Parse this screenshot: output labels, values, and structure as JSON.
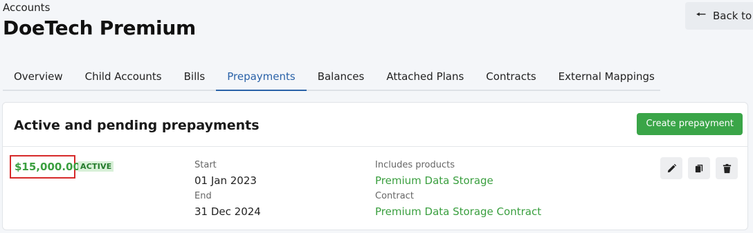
{
  "header": {
    "breadcrumb": "Accounts",
    "title": "DoeTech Premium",
    "back_label": "Back to"
  },
  "tabs": [
    {
      "label": "Overview"
    },
    {
      "label": "Child Accounts"
    },
    {
      "label": "Bills"
    },
    {
      "label": "Prepayments",
      "active": true
    },
    {
      "label": "Balances"
    },
    {
      "label": "Attached Plans"
    },
    {
      "label": "Contracts"
    },
    {
      "label": "External Mappings"
    }
  ],
  "card": {
    "title": "Active and pending prepayments",
    "create_label": "Create prepayment"
  },
  "prepayment": {
    "amount": "$15,000.00",
    "status": "ACTIVE",
    "start_label": "Start",
    "start_value": "01 Jan 2023",
    "end_label": "End",
    "end_value": "31 Dec 2024",
    "products_label": "Includes products",
    "products_value": "Premium Data Storage",
    "contract_label": "Contract",
    "contract_value": "Premium Data Storage Contract"
  },
  "colors": {
    "accent_blue": "#2a62a8",
    "green": "#3aa548",
    "highlight_red": "#d62a2a"
  },
  "icons": [
    "arrow-left-icon",
    "pencil-icon",
    "copy-icon",
    "trash-icon"
  ]
}
